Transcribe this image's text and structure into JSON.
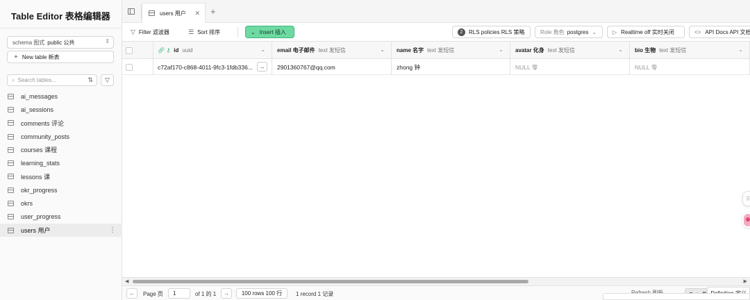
{
  "sidebar": {
    "title": "Table Editor  表格编辑器",
    "schema_label": "schema  图式",
    "schema_value": "public  公共",
    "new_table": "New table  新表",
    "search_placeholder": "Search tables...",
    "tables": [
      {
        "label": "ai_messages"
      },
      {
        "label": "ai_sessions"
      },
      {
        "label": "comments  评论"
      },
      {
        "label": "community_posts"
      },
      {
        "label": "courses  课程"
      },
      {
        "label": "learning_stats"
      },
      {
        "label": "lessons  课"
      },
      {
        "label": "okr_progress"
      },
      {
        "label": "okrs"
      },
      {
        "label": "user_progress"
      },
      {
        "label": "users  用户"
      }
    ]
  },
  "tabs": [
    {
      "label": "users  用户"
    }
  ],
  "toolbar": {
    "filter": "Filter  滤波器",
    "sort": "Sort  排序",
    "insert": "Insert  插入",
    "rls_count": "2",
    "rls": "RLS policies  RLS 策略",
    "role_label": "Role  角色",
    "role_value": "postgres",
    "realtime": "Realtime off  实时关闭",
    "api_docs": "API Docs  API 文档"
  },
  "columns": [
    {
      "name": "id",
      "type": "uuid"
    },
    {
      "name": "email  电子邮件",
      "type": "text  发短信"
    },
    {
      "name": "name  名字",
      "type": "text  发短信"
    },
    {
      "name": "avatar  化身",
      "type": "text  发短信"
    },
    {
      "name": "bio  生物",
      "type": "text  发短信"
    }
  ],
  "rows": [
    {
      "id": "c72af170-c868-4011-9fc3-1fdb336...",
      "email": "2901360767@qq.com",
      "name": "zhong  钟",
      "avatar": "NULL  零",
      "bio": "NULL  零"
    }
  ],
  "footer": {
    "page_label": "Page  页",
    "page_value": "1",
    "of_pages": "of 1  的 1",
    "rows_per_page": "100 rows  100 行",
    "record_count": "1 record  1 记录",
    "refresh": "Refresh  刷新",
    "data_tab": "Data  数据",
    "definition_tab": "Definition  定义"
  },
  "colors": {
    "accent_green": "#3bb77e",
    "insert_fill": "#6fd9a3"
  }
}
